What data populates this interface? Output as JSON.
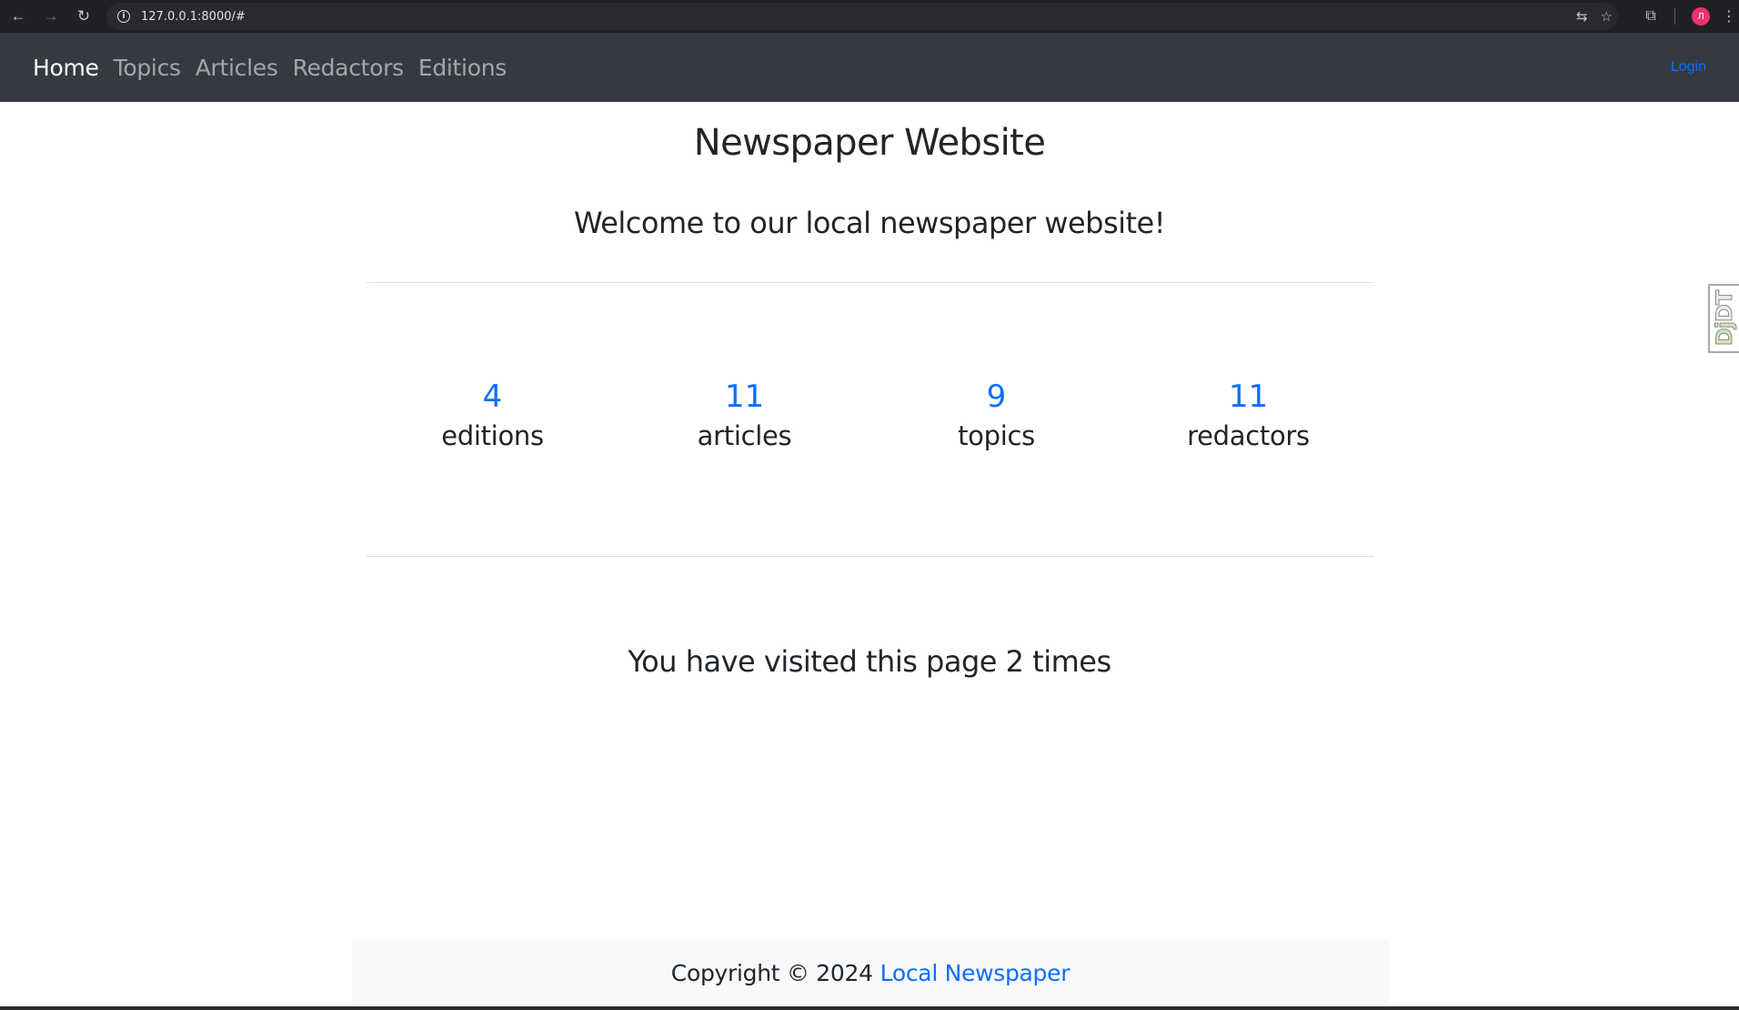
{
  "browser": {
    "url": "127.0.0.1:8000/#",
    "profile_initial": "Л"
  },
  "navbar": {
    "links": [
      {
        "label": "Home",
        "active": true
      },
      {
        "label": "Topics",
        "active": false
      },
      {
        "label": "Articles",
        "active": false
      },
      {
        "label": "Redactors",
        "active": false
      },
      {
        "label": "Editions",
        "active": false
      }
    ],
    "login_label": "Login"
  },
  "main": {
    "title": "Newspaper Website",
    "welcome": "Welcome to our local newspaper website!",
    "stats": [
      {
        "value": "4",
        "label": "editions"
      },
      {
        "value": "11",
        "label": "articles"
      },
      {
        "value": "9",
        "label": "topics"
      },
      {
        "value": "11",
        "label": "redactors"
      }
    ],
    "visits": "You have visited this page 2 times"
  },
  "footer": {
    "text": "Copyright © 2024",
    "link": "Local Newspaper"
  },
  "djdt": {
    "prefix": "Dj",
    "suffix": "DT"
  },
  "colors": {
    "navbar_bg": "#343a40",
    "accent": "#0d6efd",
    "footer_bg": "#f8f9fa"
  }
}
